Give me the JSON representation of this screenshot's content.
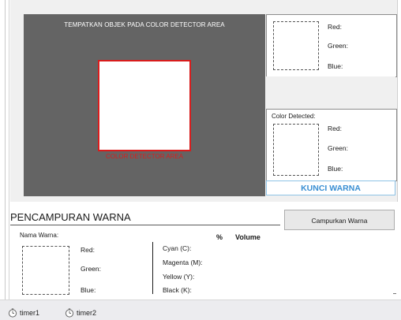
{
  "camera": {
    "title": "TEMPATKAN OBJEK PADA COLOR DETECTOR AREA",
    "detector_label": "COLOR DETECTOR AREA",
    "background_color": "#646464",
    "detector_border_color": "#d81c1c"
  },
  "rgb_panel": {
    "red_label": "Red:",
    "green_label": "Green:",
    "blue_label": "Blue:"
  },
  "detected_panel": {
    "title": "Color Detected:",
    "red_label": "Red:",
    "green_label": "Green:",
    "blue_label": "Blue:"
  },
  "kunci_button": {
    "label": "KUNCI WARNA",
    "color": "#3a8fd3"
  },
  "mixing": {
    "title": "PENCAMPURAN WARNA",
    "button_label": "Campurkan Warna",
    "name_label": "Nama Warna:",
    "percent_header": "%",
    "volume_header": "Volume",
    "rgb": {
      "red": "Red:",
      "green": "Green:",
      "blue": "Blue:"
    },
    "cmyk": {
      "cyan": "Cyan (C):",
      "magenta": "Magenta (M):",
      "yellow": "Yellow (Y):",
      "black": "Black (K):"
    }
  },
  "tray": {
    "timers": [
      {
        "name": "timer1",
        "icon": "timer-icon"
      },
      {
        "name": "timer2",
        "icon": "timer-icon"
      }
    ]
  }
}
